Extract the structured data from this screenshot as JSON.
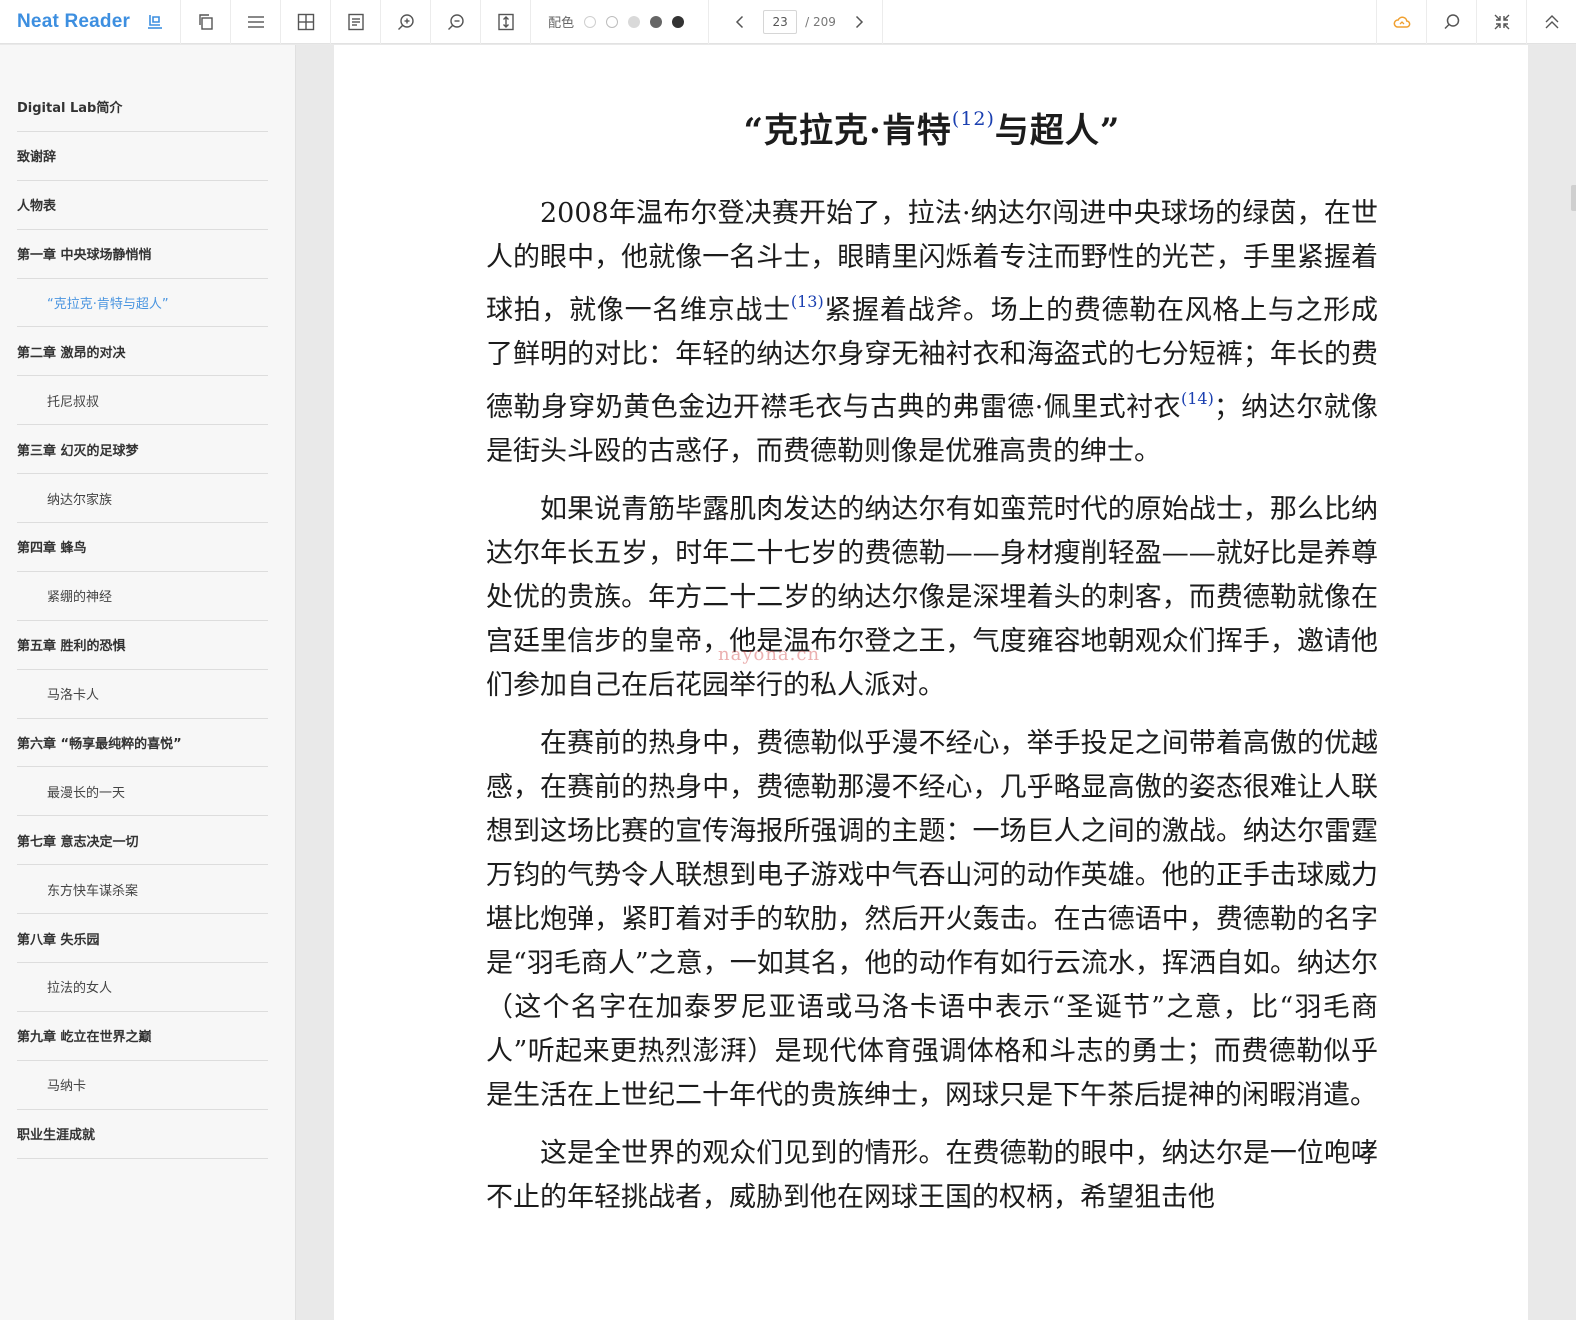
{
  "app": {
    "name": "Neat Reader"
  },
  "toolbar": {
    "color_label": "配色",
    "swatches": [
      "#ffffff",
      "#ffffff",
      "#d9d9d9",
      "#666666",
      "#333333"
    ],
    "page_current": "23",
    "page_total": "/ 209"
  },
  "toc": [
    {
      "label": "Digital Lab简介",
      "level": 1
    },
    {
      "label": "致谢辞",
      "level": 1
    },
    {
      "label": "人物表",
      "level": 1
    },
    {
      "label": "第一章 中央球场静悄悄",
      "level": 1
    },
    {
      "label": "“克拉克·肯特与超人”",
      "level": 2,
      "active": true
    },
    {
      "label": "第二章 激昂的对决",
      "level": 1
    },
    {
      "label": "托尼叔叔",
      "level": 2
    },
    {
      "label": "第三章 幻灭的足球梦",
      "level": 1
    },
    {
      "label": "纳达尔家族",
      "level": 2
    },
    {
      "label": "第四章 蜂鸟",
      "level": 1
    },
    {
      "label": "紧绷的神经",
      "level": 2
    },
    {
      "label": "第五章 胜利的恐惧",
      "level": 1
    },
    {
      "label": "马洛卡人",
      "level": 2
    },
    {
      "label": "第六章 “畅享最纯粹的喜悦”",
      "level": 1
    },
    {
      "label": "最漫长的一天",
      "level": 2
    },
    {
      "label": "第七章 意志决定一切",
      "level": 1
    },
    {
      "label": "东方快车谋杀案",
      "level": 2
    },
    {
      "label": "第八章 失乐园",
      "level": 1
    },
    {
      "label": "拉法的女人",
      "level": 2
    },
    {
      "label": "第九章 屹立在世界之巅",
      "level": 1
    },
    {
      "label": "马纳卡",
      "level": 2
    },
    {
      "label": "职业生涯成就",
      "level": 1
    }
  ],
  "page": {
    "title_a": "“克拉克·肯特",
    "title_note": "(12)",
    "title_b": "与超人”",
    "p1_a": "2008年温布尔登决赛开始了，拉法·纳达尔闯进中央球场的绿茵，在世人的眼中，他就像一名斗士，眼睛里闪烁着专注而野性的光芒，手里紧握着球拍，就像一名维京战士",
    "p1_note1": "(13)",
    "p1_b": "紧握着战斧。场上的费德勒在风格上与之形成了鲜明的对比：年轻的纳达尔身穿无袖衬衣和海盗式的七分短裤；年长的费德勒身穿奶黄色金边开襟毛衣与古典的弗雷德·佩里式衬衣",
    "p1_note2": "(14)",
    "p1_c": "；纳达尔就像是街头斗殴的古惑仔，而费德勒则像是优雅高贵的绅士。",
    "p2": "如果说青筋毕露肌肉发达的纳达尔有如蛮荒时代的原始战士，那么比纳达尔年长五岁，时年二十七岁的费德勒——身材瘦削轻盈——就好比是养尊处优的贵族。年方二十二岁的纳达尔像是深埋着头的刺客，而费德勒就像在宫廷里信步的皇帝，他是温布尔登之王，气度雍容地朝观众们挥手，邀请他们参加自己在后花园举行的私人派对。",
    "p3": "在赛前的热身中，费德勒似乎漫不经心，举手投足之间带着高傲的优越感，在赛前的热身中，费德勒那漫不经心，几乎略显高傲的姿态很难让人联想到这场比赛的宣传海报所强调的主题：一场巨人之间的激战。纳达尔雷霆万钧的气势令人联想到电子游戏中气吞山河的动作英雄。他的正手击球威力堪比炮弹，紧盯着对手的软肋，然后开火轰击。在古德语中，费德勒的名字是“羽毛商人”之意，一如其名，他的动作有如行云流水，挥洒自如。纳达尔（这个名字在加泰罗尼亚语或马洛卡语中表示“圣诞节”之意，比“羽毛商人”听起来更热烈澎湃）是现代体育强调体格和斗志的勇士；而费德勒似乎是生活在上世纪二十年代的贵族绅士，网球只是下午茶后提神的闲暇消遣。",
    "p4": "这是全世界的观众们见到的情形。在费德勒的眼中，纳达尔是一位咆哮不止的年轻挑战者，威胁到他在网球王国的权柄，希望狙击他",
    "watermark": "nayona.cn"
  }
}
